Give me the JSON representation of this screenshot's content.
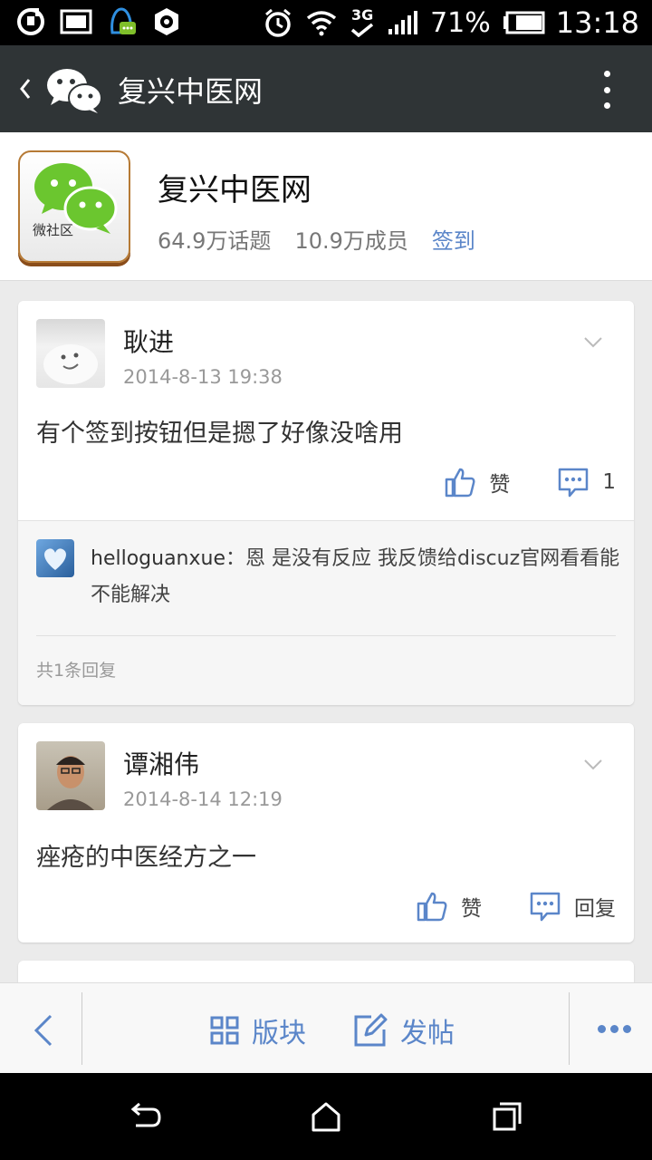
{
  "status_bar": {
    "battery": "71%",
    "time": "13:18",
    "network": "3G",
    "icons": [
      "sync-icon",
      "picture-icon",
      "qq-icon",
      "settings-icon",
      "alarm-icon",
      "wifi-icon",
      "signal-icon",
      "battery-icon"
    ]
  },
  "action_bar": {
    "title": "复兴中医网",
    "back_icon": "chevron-left-icon",
    "logo_icon": "wechat-icon",
    "overflow_icon": "more-vertical-icon"
  },
  "forum": {
    "icon_label": "微社区",
    "title": "复兴中医网",
    "topics": "64.9万话题",
    "members": "10.9万成员",
    "sign_in": "签到"
  },
  "posts": [
    {
      "author": "耿进",
      "date": "2014-8-13 19:38",
      "content": "有个签到按钮但是摁了好像没啥用",
      "like_label": "赞",
      "comment_count": "1",
      "reply": {
        "user": "helloguanxue",
        "separator": "：",
        "text": "恩 是没有反应 我反馈给discuz官网看看能不能解决"
      },
      "reply_total": "共1条回复"
    },
    {
      "author": "谭湘伟",
      "date": "2014-8-14 12:19",
      "content": "痤疮的中医经方之一",
      "like_label": "赞",
      "reply_label": "回复"
    }
  ],
  "toolbar": {
    "sections_label": "版块",
    "post_label": "发帖"
  },
  "colors": {
    "accent": "#5b86c9",
    "actionbar": "#2f3436",
    "background": "#ebebeb"
  }
}
